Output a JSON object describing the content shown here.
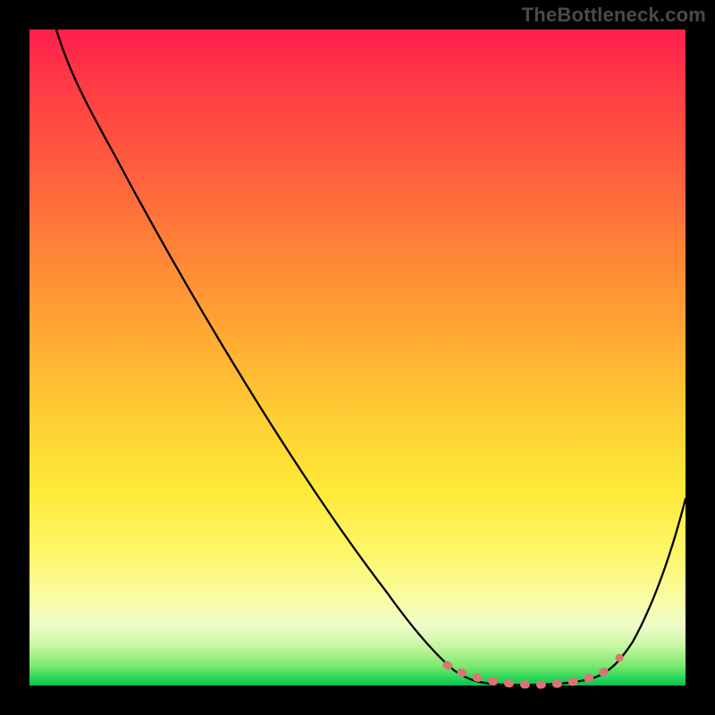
{
  "watermark": "TheBottleneck.com",
  "colors": {
    "gradient_top": "#ff1f4b",
    "gradient_mid": "#fee937",
    "gradient_bottom": "#0fbf4e",
    "curve": "#000000",
    "dots": "#d97474",
    "frame": "#000000"
  },
  "chart_data": {
    "type": "line",
    "title": "",
    "xlabel": "",
    "ylabel": "",
    "xlim": [
      0,
      100
    ],
    "ylim": [
      0,
      100
    ],
    "grid": false,
    "legend": false,
    "series": [
      {
        "name": "bottleneck-curve",
        "x": [
          4,
          10,
          18,
          26,
          34,
          42,
          50,
          58,
          62,
          66,
          70,
          74,
          78,
          82,
          86,
          90,
          96,
          100
        ],
        "y": [
          100,
          92,
          80,
          68,
          55,
          43,
          31,
          18,
          12,
          6,
          2,
          0,
          0,
          0,
          2,
          7,
          20,
          33
        ]
      }
    ],
    "highlight": {
      "name": "optimal-range-dots",
      "x_range": [
        62,
        88
      ],
      "y_level": 0
    }
  }
}
